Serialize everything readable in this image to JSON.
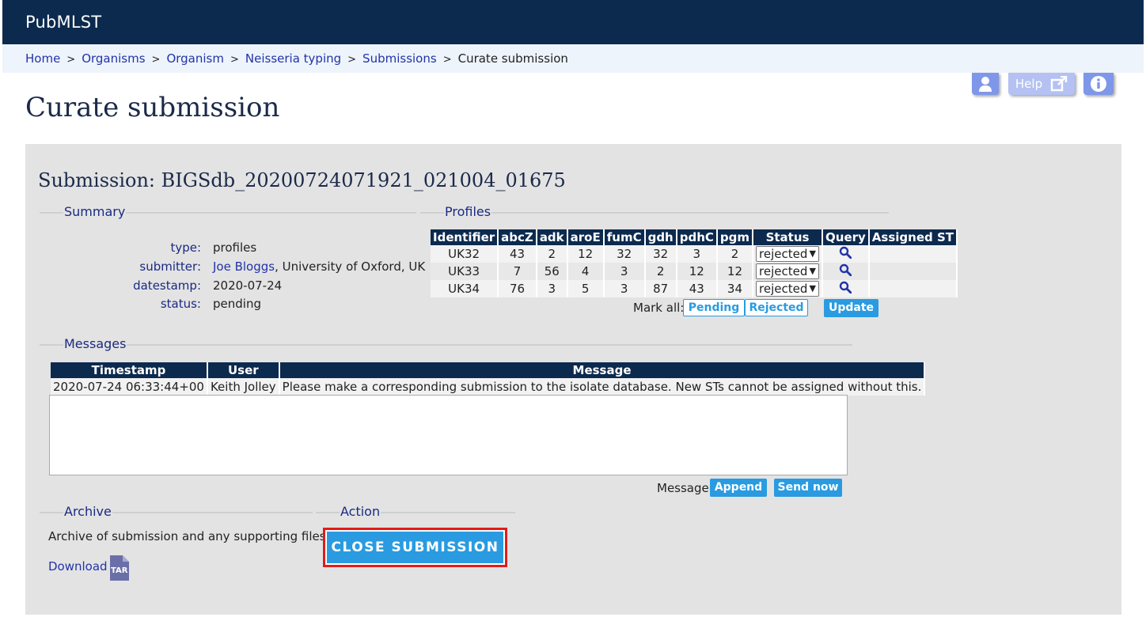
{
  "app": {
    "brand": "PubMLST"
  },
  "breadcrumb": [
    {
      "label": "Home"
    },
    {
      "label": "Organisms"
    },
    {
      "label": "Organism"
    },
    {
      "label": "Neisseria typing"
    },
    {
      "label": "Submissions"
    },
    {
      "label": "Curate submission"
    }
  ],
  "toolbar": {
    "help_label": "Help"
  },
  "page_title": "Curate submission",
  "submission_title": "Submission: BIGSdb_20200724071921_021004_01675",
  "summary": {
    "heading": "Summary",
    "type_label": "type:",
    "type_value": "profiles",
    "submitter_label": "submitter:",
    "submitter_name": "Joe Bloggs",
    "submitter_org": ", University of Oxford, UK",
    "datestamp_label": "datestamp:",
    "datestamp_value": "2020-07-24",
    "status_label": "status:",
    "status_value": "pending"
  },
  "profiles": {
    "heading": "Profiles",
    "columns": [
      "Identifier",
      "abcZ",
      "adk",
      "aroE",
      "fumC",
      "gdh",
      "pdhC",
      "pgm",
      "Status",
      "Query",
      "Assigned ST"
    ],
    "rows": [
      {
        "id": "UK32",
        "abcZ": "43",
        "adk": "2",
        "aroE": "12",
        "fumC": "32",
        "gdh": "32",
        "pdhC": "3",
        "pgm": "2",
        "status": "rejected",
        "assigned": ""
      },
      {
        "id": "UK33",
        "abcZ": "7",
        "adk": "56",
        "aroE": "4",
        "fumC": "3",
        "gdh": "2",
        "pdhC": "12",
        "pgm": "12",
        "status": "rejected",
        "assigned": ""
      },
      {
        "id": "UK34",
        "abcZ": "76",
        "adk": "3",
        "aroE": "5",
        "fumC": "3",
        "gdh": "87",
        "pdhC": "43",
        "pgm": "34",
        "status": "rejected",
        "assigned": ""
      }
    ],
    "mark_all_label": "Mark all:",
    "pending_label": "Pending",
    "rejected_label": "Rejected",
    "update_label": "Update"
  },
  "messages": {
    "heading": "Messages",
    "columns": [
      "Timestamp",
      "User",
      "Message"
    ],
    "rows": [
      {
        "timestamp": "2020-07-24 06:33:44+00",
        "user": "Keith Jolley",
        "message": "Please make a corresponding submission to the isolate database. New STs cannot be assigned without this."
      }
    ],
    "message_label": "Message:",
    "append_label": "Append",
    "send_label": "Send now"
  },
  "archive": {
    "heading": "Archive",
    "text": "Archive of submission and any supporting files:",
    "download_label": "Download",
    "file_badge": "TAR"
  },
  "action": {
    "heading": "Action",
    "close_label": "CLOSE SUBMISSION"
  },
  "colors": {
    "navy": "#0c2a4e",
    "accent": "#2a9be0",
    "link": "#2233aa",
    "highlight": "#e31b1b"
  }
}
